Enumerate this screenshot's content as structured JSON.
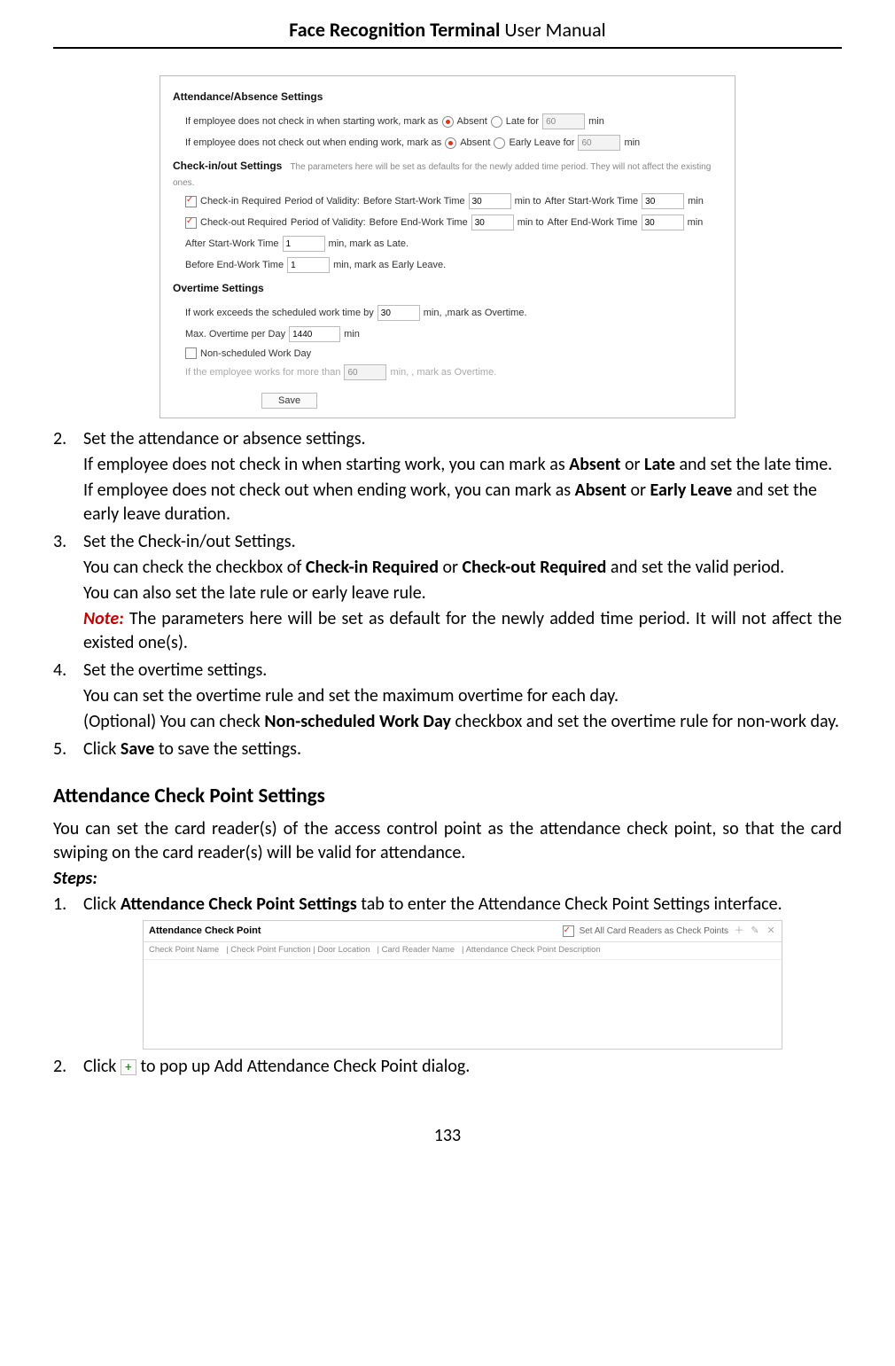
{
  "header": {
    "bold": "Face Recognition Terminal",
    "rest": " User Manual"
  },
  "panel": {
    "sec1_title": "Attendance/Absence Settings",
    "row_absent_in_label": "If employee does not check in when starting work, mark as",
    "absent_label": "Absent",
    "late_for_label": "Late for",
    "late_for_value": "60",
    "min": "min",
    "row_absent_out_label": "If employee does not check out when ending work, mark as",
    "early_leave_for_label": "Early Leave for",
    "early_leave_value": "60",
    "sec2_title": "Check-in/out Settings",
    "sec2_hint": "The parameters here will be set as defaults for the newly added time period. They will not affect the existing ones.",
    "checkin_req": "Check-in Required",
    "checkout_req": "Check-out Required",
    "period_validity": "Period of Validity:",
    "before_start": "Before Start-Work Time",
    "after_start": "After Start-Work Time",
    "before_end": "Before End-Work Time",
    "after_end": "After End-Work Time",
    "val30": "30",
    "min_to": "min  to",
    "after_start_work": "After Start-Work Time",
    "val1": "1",
    "mark_late": "min,  mark as Late.",
    "before_end_work": "Before End-Work Time",
    "mark_early": "min,  mark as Early Leave.",
    "sec3_title": "Overtime Settings",
    "exceed_label": "If work exceeds the scheduled work time by",
    "mark_overtime": "min,  ,mark as Overtime.",
    "max_ot_label": "Max. Overtime per Day",
    "max_ot_value": "1440",
    "nonsched": "Non-scheduled Work Day",
    "works_more": "If the employee works for more than",
    "works_more_val": "60",
    "works_more_suffix": "min,  , mark as Overtime.",
    "save": "Save"
  },
  "body": {
    "item2_head": "Set the attendance or absence settings.",
    "item2_p1a": "If employee does not check in when starting work, you can mark as ",
    "item2_p1b": " or ",
    "item2_p1c": " and set the late time.",
    "absent_b": "Absent",
    "late_b": "Late",
    "item2_p2a": "If employee does not check out when ending work, you can mark as ",
    "item2_p2b": " or ",
    "item2_p2c": " and set the early leave duration.",
    "early_leave_b": "Early Leave",
    "item3_head": "Set the Check-in/out Settings.",
    "item3_p1a": "You can check the checkbox of ",
    "checkin_b": "Check-in Required",
    "item3_p1b": " or ",
    "checkout_b": "Check-out Required",
    "item3_p1c": " and set the valid period.",
    "item3_p2": "You can also set the late rule or early leave rule.",
    "note_label": "Note:",
    "item3_note": " The parameters here will be set as default for the newly added time period. It will not affect the existed one(s).",
    "item4_head": "Set the overtime settings.",
    "item4_p1": "You can set the overtime rule and set the maximum overtime for each day.",
    "item4_p2a": "(Optional) You can check ",
    "nonsched_b": "Non-scheduled Work Day",
    "item4_p2b": " checkbox and set the overtime rule for non-work day.",
    "item5a": "Click ",
    "save_b": "Save",
    "item5b": " to save the settings.",
    "heading": "Attendance Check Point Settings",
    "intro": "You can set the card reader(s) of the access control point as the attendance check point, so that the card swiping on the card reader(s) will be valid for attendance.",
    "steps": "Steps:",
    "step1a": "Click ",
    "step1_b": "Attendance Check Point Settings",
    "step1b": " tab to enter the Attendance Check Point Settings interface.",
    "step2a": "Click ",
    "step2b": " to pop up Add Attendance Check Point dialog."
  },
  "checkpoint": {
    "title": "Attendance Check Point",
    "setall": "Set All Card Readers as Check Points",
    "col1": "Check Point Name",
    "col2": "| Check Point Function | Door Location",
    "col3": "| Card Reader Name",
    "col4": "| Attendance Check Point Description"
  },
  "page_number": "133"
}
